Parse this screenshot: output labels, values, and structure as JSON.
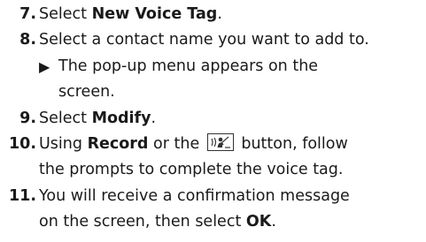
{
  "steps": [
    {
      "number": "7.",
      "lead": "Select ",
      "bold": "New Voice Tag",
      "trail": "."
    },
    {
      "number": "8.",
      "text": "Select a contact name you want to add to.",
      "note_line1": "The pop-up menu appears on the",
      "note_line2": "screen."
    },
    {
      "number": "9.",
      "lead": "Select ",
      "bold": "Modify",
      "trail": "."
    },
    {
      "number": "10.",
      "lead": "Using ",
      "bold": "Record",
      "mid": " or the ",
      "icon": "voice-talk-button-icon",
      "after": " button, follow",
      "line2": "the prompts to complete the voice tag."
    },
    {
      "number": "11.",
      "line1": "You will receive a confirmation message",
      "lead2": "on the screen, then select ",
      "bold": "OK",
      "trail": "."
    }
  ]
}
